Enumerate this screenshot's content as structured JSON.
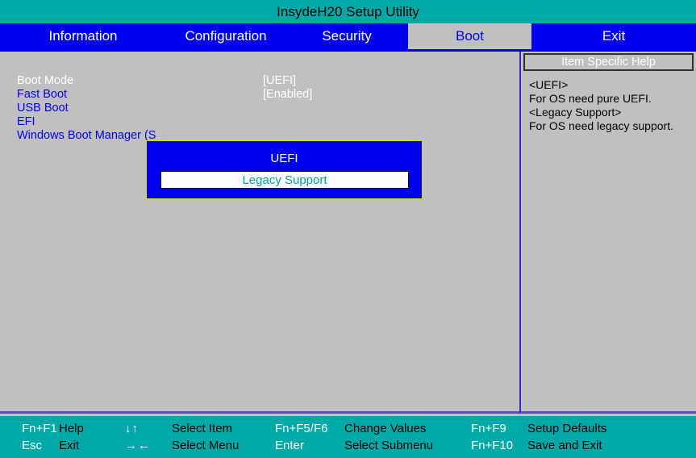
{
  "window": {
    "title": "InsydeH20 Setup Utility"
  },
  "menubar": {
    "tabs": [
      {
        "label": "Information",
        "active": false
      },
      {
        "label": "Configuration",
        "active": false
      },
      {
        "label": "Security",
        "active": false
      },
      {
        "label": "Boot",
        "active": true
      },
      {
        "label": "Exit",
        "active": false
      }
    ]
  },
  "settings": [
    {
      "label": "Boot Mode",
      "value": "[UEFI]",
      "selected": true
    },
    {
      "label": "Fast Boot",
      "value": "[Enabled]",
      "selected": false
    },
    {
      "label": "USB Boot",
      "value": "",
      "selected": false
    },
    {
      "label": "EFI",
      "value": "",
      "selected": false
    },
    {
      "label": "Windows Boot Manager (S",
      "value": "",
      "selected": false
    }
  ],
  "popup": {
    "title": "UEFI",
    "option": "Legacy Support"
  },
  "help": {
    "header": "Item Specific Help",
    "lines": [
      "<UEFI>",
      "For OS need pure UEFI.",
      "<Legacy Support>",
      "For OS need legacy support."
    ]
  },
  "statusbar": {
    "entries": [
      {
        "key": "Fn+F1",
        "desc": "Help"
      },
      {
        "key": "Esc",
        "desc": "Exit"
      },
      {
        "key": "↓↑",
        "desc": "Select Item"
      },
      {
        "key": "→←",
        "desc": "Select Menu"
      },
      {
        "key": "Fn+F5/F6",
        "desc": "Change Values"
      },
      {
        "key": "Enter",
        "desc": "Select Submenu"
      },
      {
        "key": "Fn+F9",
        "desc": "Setup Defaults"
      },
      {
        "key": "Fn+F10",
        "desc": "Save and Exit"
      }
    ]
  },
  "colors": {
    "teal": "#00a8a8",
    "blue": "#0000f0",
    "gray": "#c0c0c0",
    "popup_border": "#d8d800",
    "option_text": "#00a0a0"
  }
}
